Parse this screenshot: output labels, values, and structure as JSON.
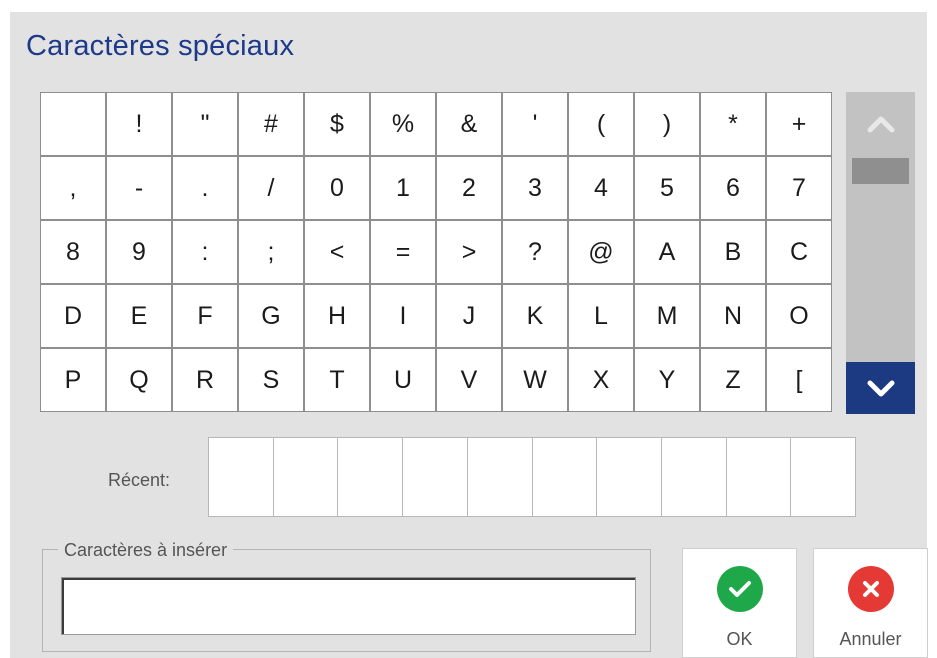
{
  "dialog": {
    "title": "Caractères spéciaux"
  },
  "characters": [
    " ",
    "!",
    "\"",
    "#",
    "$",
    "%",
    "&",
    "'",
    "(",
    ")",
    "*",
    "+",
    ",",
    "-",
    ".",
    "/",
    "0",
    "1",
    "2",
    "3",
    "4",
    "5",
    "6",
    "7",
    "8",
    "9",
    ":",
    ";",
    "<",
    "=",
    ">",
    "?",
    "@",
    "A",
    "B",
    "C",
    "D",
    "E",
    "F",
    "G",
    "H",
    "I",
    "J",
    "K",
    "L",
    "M",
    "N",
    "O",
    "P",
    "Q",
    "R",
    "S",
    "T",
    "U",
    "V",
    "W",
    "X",
    "Y",
    "Z",
    "["
  ],
  "scrollbar": {
    "up_icon": "chevron-up-icon",
    "down_icon": "chevron-down-icon",
    "active_color": "#1b3a82"
  },
  "recent": {
    "label": "Récent:",
    "slots": [
      "",
      "",
      "",
      "",
      "",
      "",
      "",
      "",
      "",
      ""
    ]
  },
  "insert": {
    "label": "Caractères à insérer",
    "value": ""
  },
  "buttons": {
    "ok_label": "OK",
    "ok_icon": "check-icon",
    "ok_color": "#1fa84a",
    "cancel_label": "Annuler",
    "cancel_icon": "close-icon",
    "cancel_color": "#e53935"
  },
  "colors": {
    "title": "#1d3a8a",
    "background": "#e2e2e2"
  }
}
